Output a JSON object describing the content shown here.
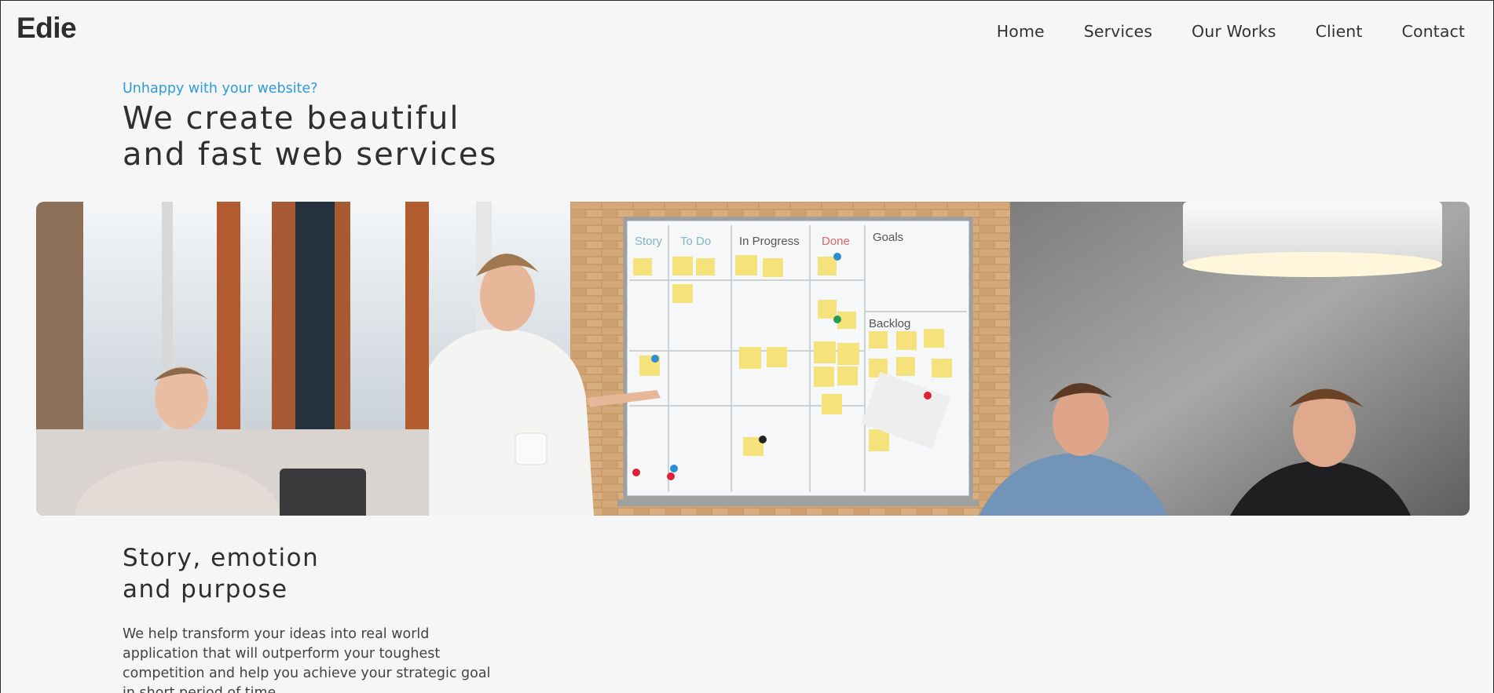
{
  "header": {
    "logo": "Edie",
    "nav": [
      "Home",
      "Services",
      "Our Works",
      "Client",
      "Contact"
    ]
  },
  "hero": {
    "eyebrow": "Unhappy with your website?",
    "headline_line1": "We create beautiful",
    "headline_line2": "and fast web services",
    "image_alt": "Team meeting around a whiteboard with sticky notes",
    "whiteboard_columns": [
      "Story",
      "To Do",
      "In Progress",
      "Done",
      "Goals"
    ],
    "whiteboard_backlog": "Backlog"
  },
  "story": {
    "title_line1": "Story, emotion",
    "title_line2": "and purpose",
    "body": "We help transform your ideas into real world application that will outperform your toughest competition and help you achieve your strategic goal in short period of time."
  },
  "colors": {
    "background": "#f6f6f6",
    "accent": "#2e9bd6",
    "text": "#2f2f2f"
  }
}
